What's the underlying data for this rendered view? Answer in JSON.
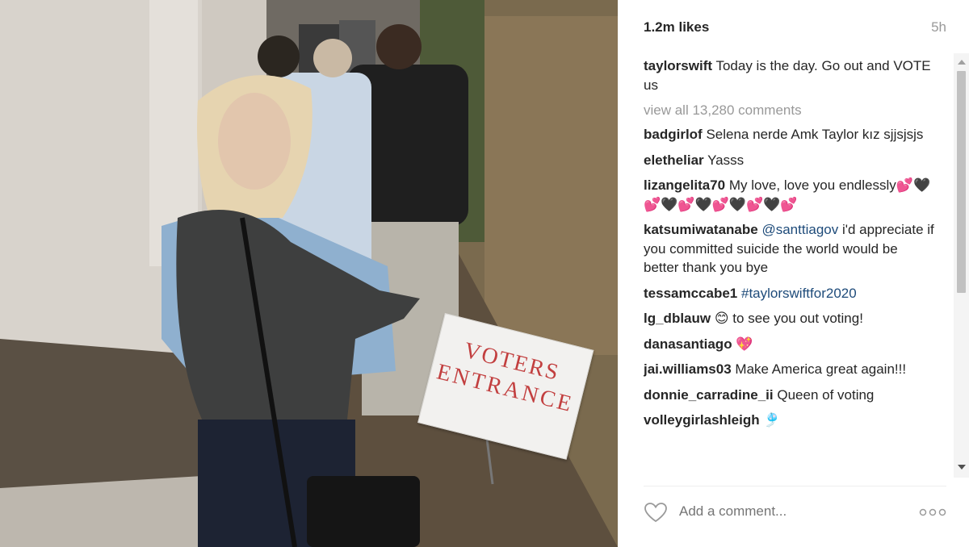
{
  "post": {
    "likes": "1.2m likes",
    "time_ago": "5h",
    "caption": {
      "user": "taylorswift",
      "text": "Today is the day. Go out and VOTE us"
    },
    "view_all_comments": "view all 13,280 comments",
    "photo": {
      "sign_line1": "VOTERS",
      "sign_line2": "ENTRANCE"
    }
  },
  "comments": [
    {
      "user": "badgirlof",
      "text": "Selena nerde Amk Taylor kız sjjsjsjs"
    },
    {
      "user": "eletheliar",
      "text": "Yasss"
    },
    {
      "user": "lizangelita70",
      "text": "My love, love you endlessly💕🖤💕🖤💕🖤💕🖤💕🖤💕"
    },
    {
      "user": "katsumiwatanabe",
      "mention": "@santtiagov",
      "text": "i'd appreciate if you committed suicide the world would be better thank you bye"
    },
    {
      "user": "tessamccabe1",
      "mention": "#taylorswiftfor2020",
      "text": ""
    },
    {
      "user": "lg_dblauw",
      "text": "😊 to see you out voting!"
    },
    {
      "user": "danasantiago",
      "text": "💖"
    },
    {
      "user": "jai.williams03",
      "text": "Make America great again!!!"
    },
    {
      "user": "donnie_carradine_ii",
      "text": "Queen of voting"
    },
    {
      "user": "volleygirlashleigh",
      "text": "🎐"
    }
  ],
  "footer": {
    "add_comment_placeholder": "Add a comment...",
    "icons": [
      "heart-icon",
      "more-options-icon"
    ]
  },
  "colors": {
    "text": "#262626",
    "muted": "#999999",
    "link": "#1e4b7a",
    "sign_text": "#c23f3f"
  }
}
